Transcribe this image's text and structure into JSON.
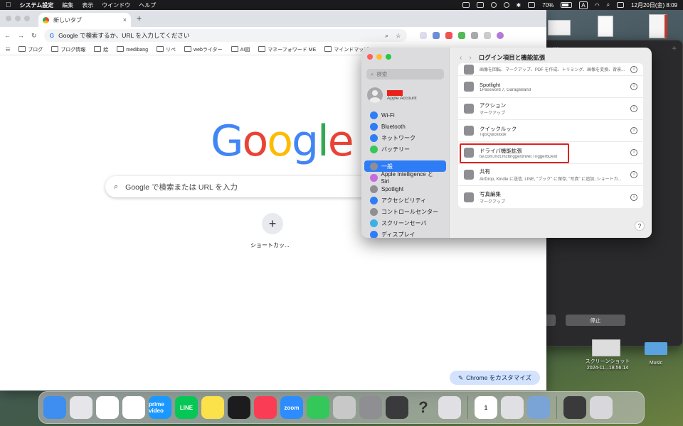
{
  "menubar": {
    "app_name": "システム設定",
    "items": [
      "編集",
      "表示",
      "ウインドウ",
      "ヘルプ"
    ],
    "battery": "70%",
    "ime": "A",
    "datetime": "12月20日(金) 8:09"
  },
  "chrome": {
    "tab_title": "新しいタブ",
    "omnibox_placeholder": "Google で検索するか、URL を入力してください",
    "bookmarks": [
      "ブログ",
      "ブログ情報",
      "絵",
      "medibang",
      "リペ",
      "webライター",
      "AI図",
      "マネーフォワード ME",
      "マインドマッピン"
    ],
    "logo_letters": [
      "G",
      "o",
      "o",
      "g",
      "l",
      "e"
    ],
    "search_placeholder": "Google で検索または URL を入力",
    "shortcut_label": "ショートカッ...",
    "customize_label": "Chrome をカスタマイズ"
  },
  "settings": {
    "search_placeholder": "検索",
    "account_sub": "Apple Account",
    "title": "ログイン項目と機能拡張",
    "sidebar": [
      {
        "label": "Wi-Fi",
        "color": "#2f7df6",
        "icon": "wifi-icon"
      },
      {
        "label": "Bluetooth",
        "color": "#2f7df6",
        "icon": "bluetooth-icon"
      },
      {
        "label": "ネットワーク",
        "color": "#2f7df6",
        "icon": "globe-icon"
      },
      {
        "label": "バッテリー",
        "color": "#34c759",
        "icon": "battery-icon"
      },
      {
        "label": "一般",
        "color": "#8e8e93",
        "icon": "gear-icon",
        "active": true
      },
      {
        "label": "Apple Intelligence と Siri",
        "color": "#c86be0",
        "icon": "siri-icon"
      },
      {
        "label": "Spotlight",
        "color": "#8e8e93",
        "icon": "magnifier-icon"
      },
      {
        "label": "アクセシビリティ",
        "color": "#2f7df6",
        "icon": "accessibility-icon"
      },
      {
        "label": "コントロールセンター",
        "color": "#8e8e93",
        "icon": "control-center-icon"
      },
      {
        "label": "スクリーンセーバ",
        "color": "#3ab0e6",
        "icon": "screensaver-icon"
      },
      {
        "label": "ディスプレイ",
        "color": "#2f7df6",
        "icon": "display-icon"
      }
    ],
    "rows": [
      {
        "title": "",
        "sub": "画像を回転、マークアップ、PDF を作成、トリミング、画像を変換、背景...",
        "top": true
      },
      {
        "title": "Spotlight",
        "sub": "1Password 7, GarageBand"
      },
      {
        "title": "アクション",
        "sub": "マークアップ"
      },
      {
        "title": "クイックルック",
        "sub": "TipsQuicklook"
      },
      {
        "title": "ドライバ機能拡張",
        "sub": "tw.com.mct.mcttriggerdriver.Trigger6Dext",
        "highlight": true
      },
      {
        "title": "共有",
        "sub": "AirDrop, Kindle に送信, LINE, \"ブック\" に保存, \"写真\" に追加, ショートカ..."
      },
      {
        "title": "写真編集",
        "sub": "マークアップ"
      }
    ],
    "info_glyph": "i",
    "help_glyph": "?"
  },
  "dark_window": {
    "button_left": "ラップ",
    "button_right": "停止"
  },
  "desktop": {
    "screenshot_label_1": "スクリーンショット",
    "screenshot_label_2": "2024-11...18.56.14",
    "folder_label": "Music"
  },
  "dock": [
    {
      "name": "finder-icon",
      "bg": "#3d8ef0",
      "label": ""
    },
    {
      "name": "launchpad-icon",
      "bg": "#e6e6ea",
      "label": ""
    },
    {
      "name": "chrome-icon",
      "bg": "#ffffff",
      "label": ""
    },
    {
      "name": "photos-icon",
      "bg": "#ffffff",
      "label": ""
    },
    {
      "name": "prime-video-icon",
      "bg": "#1a98ff",
      "label": "prime video"
    },
    {
      "name": "line-icon",
      "bg": "#06c755",
      "label": "LINE"
    },
    {
      "name": "notes-icon",
      "bg": "#fbe14a",
      "label": ""
    },
    {
      "name": "clock-icon",
      "bg": "#1c1c1e",
      "label": ""
    },
    {
      "name": "music-icon",
      "bg": "#fa3c55",
      "label": ""
    },
    {
      "name": "zoom-icon",
      "bg": "#2d8cff",
      "label": "zoom"
    },
    {
      "name": "facetime-icon",
      "bg": "#34c759",
      "label": ""
    },
    {
      "name": "mouse-app-icon",
      "bg": "#c8c8c8",
      "label": ""
    },
    {
      "name": "system-settings-icon",
      "bg": "#8e8e93",
      "label": ""
    },
    {
      "name": "calculator-icon",
      "bg": "#3a3a3c",
      "label": ""
    },
    {
      "name": "help-app-icon",
      "bg": "transparent",
      "label": "?"
    },
    {
      "name": "iphone-mirroring-icon",
      "bg": "#e0e0e4",
      "label": ""
    },
    {
      "sep": true
    },
    {
      "name": "1password-icon",
      "bg": "#ffffff",
      "label": "1"
    },
    {
      "name": "display-app-icon",
      "bg": "#e0e0e4",
      "label": ""
    },
    {
      "name": "preview-app-icon",
      "bg": "#7aa3d6",
      "label": ""
    },
    {
      "sep": true
    },
    {
      "name": "downloads-stack-icon",
      "bg": "#3a3a3c",
      "label": ""
    },
    {
      "name": "trash-icon",
      "bg": "#d8d8dc",
      "label": ""
    }
  ]
}
